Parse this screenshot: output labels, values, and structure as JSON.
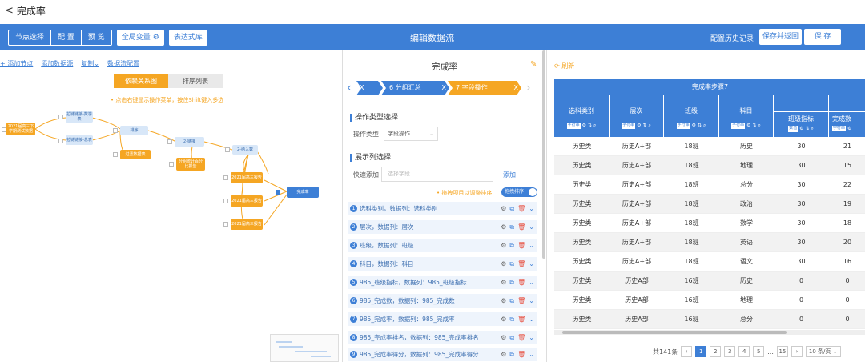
{
  "window": {
    "back_icon": "chevron-left-icon",
    "title": "完成率"
  },
  "toolbar": {
    "segment": [
      "节点选择",
      "配 置",
      "预 览"
    ],
    "global_var": "全局变量",
    "expr_test": "表达式库",
    "center_title": "编辑数据流",
    "history_link": "配置历史记录",
    "save_return": "保存并返回",
    "save": "保 存",
    "accent": "#3d7fd6"
  },
  "left": {
    "links": [
      "+ 添加节点",
      "添加数据源",
      "复制",
      "数据流配置"
    ],
    "copy_caret": "⌄",
    "tabs": [
      "依赖关系图",
      "排序列表"
    ],
    "hint": "• 点击右键显示操作菜单，按住Shift键入多选",
    "nodes": [
      {
        "id": "n1",
        "text": "2021届高三下学期测试数据",
        "color": "o"
      },
      {
        "id": "n2",
        "text": "拉链链接-数学表",
        "color": "l"
      },
      {
        "id": "n3",
        "text": "拉链链接-总表",
        "color": "l"
      },
      {
        "id": "n4",
        "text": "排序",
        "color": "l"
      },
      {
        "id": "n5",
        "text": "过滤数据表",
        "color": "o"
      },
      {
        "id": "n6",
        "text": "2-链接",
        "color": "l"
      },
      {
        "id": "n7",
        "text": "分组统计百分比报告",
        "color": "o"
      },
      {
        "id": "n8",
        "text": "2-纳入数",
        "color": "l"
      },
      {
        "id": "n9",
        "text": "2021届高三报告",
        "color": "o"
      },
      {
        "id": "n10",
        "text": "2021届高三报告",
        "color": "o"
      },
      {
        "id": "n11",
        "text": "2021届高三报告",
        "color": "o"
      },
      {
        "id": "n12",
        "text": "完成率",
        "color": "b"
      }
    ]
  },
  "middle": {
    "title": "完成率",
    "steps": [
      "X",
      "6 分组汇总",
      "X",
      "7 字段操作",
      "X"
    ],
    "section1": "操作类型选择",
    "op_label": "操作类型",
    "op_value": "字段操作",
    "section2": "展示列选择",
    "quick_add_label": "快速添加",
    "quick_add_placeholder": "选择字段",
    "add_link": "添加",
    "drag_hint": "• 拖拽项目以调整排序",
    "toggle_label": "拖拽排序",
    "columns": [
      {
        "num": "1",
        "text": "选科类别，数据列：选科类别"
      },
      {
        "num": "2",
        "text": "层次，数据列：层次"
      },
      {
        "num": "3",
        "text": "班级，数据列：班级"
      },
      {
        "num": "4",
        "text": "科目，数据列：科目"
      },
      {
        "num": "5",
        "text": "985_班级指标，数据列：985_班级指标"
      },
      {
        "num": "6",
        "text": "985_完成数，数据列：985_完成数"
      },
      {
        "num": "7",
        "text": "985_完成率，数据列：985_完成率"
      },
      {
        "num": "8",
        "text": "985_完成率排名，数据列：985_完成率排名"
      },
      {
        "num": "9",
        "text": "985_完成率得分，数据列：985_完成率得分"
      }
    ]
  },
  "right": {
    "refresh": "刷新",
    "table_title": "完成率步骤7",
    "headers": [
      "选科类别",
      "层次",
      "班级",
      "科目",
      "班级指标",
      "完成数"
    ],
    "tools_tag": [
      "字符串",
      "字符串",
      "字符串",
      "字符串",
      "数值",
      "字符串"
    ],
    "rows": [
      [
        "历史类",
        "历史A+部",
        "18班",
        "历史",
        "30",
        "21"
      ],
      [
        "历史类",
        "历史A+部",
        "18班",
        "地理",
        "30",
        "15"
      ],
      [
        "历史类",
        "历史A+部",
        "18班",
        "总分",
        "30",
        "22"
      ],
      [
        "历史类",
        "历史A+部",
        "18班",
        "政治",
        "30",
        "19"
      ],
      [
        "历史类",
        "历史A+部",
        "18班",
        "数学",
        "30",
        "18"
      ],
      [
        "历史类",
        "历史A+部",
        "18班",
        "英语",
        "30",
        "20"
      ],
      [
        "历史类",
        "历史A+部",
        "18班",
        "语文",
        "30",
        "16"
      ],
      [
        "历史类",
        "历史A部",
        "16班",
        "历史",
        "0",
        "0"
      ],
      [
        "历史类",
        "历史A部",
        "16班",
        "地理",
        "0",
        "0"
      ],
      [
        "历史类",
        "历史A部",
        "16班",
        "总分",
        "0",
        "0"
      ]
    ],
    "pager": {
      "total": "共141条",
      "pages": [
        "1",
        "2",
        "3",
        "4",
        "5",
        "...",
        "15"
      ],
      "page_size": "10 条/页"
    }
  }
}
